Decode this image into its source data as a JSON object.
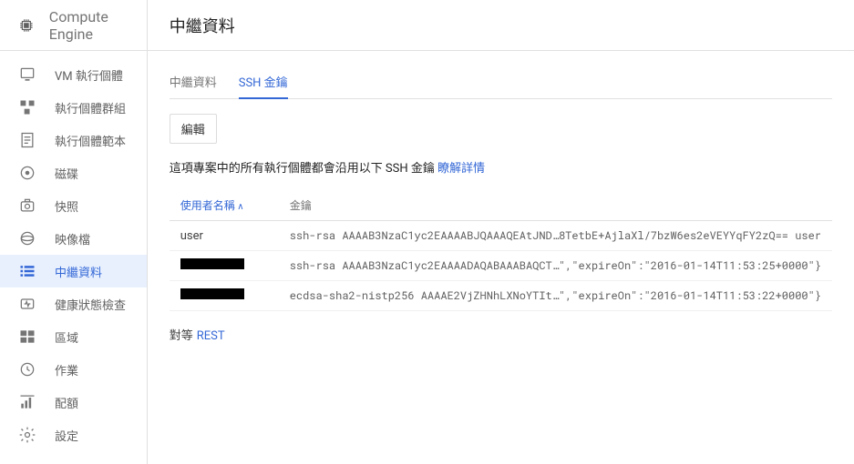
{
  "product_name": "Compute Engine",
  "page_title": "中繼資料",
  "sidebar": {
    "items": [
      {
        "label": "VM 執行個體"
      },
      {
        "label": "執行個體群組"
      },
      {
        "label": "執行個體範本"
      },
      {
        "label": "磁碟"
      },
      {
        "label": "快照"
      },
      {
        "label": "映像檔"
      },
      {
        "label": "中繼資料"
      },
      {
        "label": "健康狀態檢查"
      },
      {
        "label": "區域"
      },
      {
        "label": "作業"
      },
      {
        "label": "配額"
      },
      {
        "label": "設定"
      }
    ]
  },
  "tabs": {
    "metadata": "中繼資料",
    "ssh_keys": "SSH 金鑰"
  },
  "edit_button": "編輯",
  "description_prefix": "這項專案中的所有執行個體都會沿用以下 SSH 金鑰 ",
  "description_link": "瞭解詳情",
  "table": {
    "col_user": "使用者名稱",
    "col_key": "金鑰",
    "rows": [
      {
        "user": "user",
        "key": "ssh-rsa AAAAB3NzaC1yc2EAAAABJQAAAQEAtJND…8TetbE+AjlaXl/7bzW6es2eVEYYqFY2zQ== user"
      },
      {
        "user": "",
        "key": "ssh-rsa AAAAB3NzaC1yc2EAAAADAQABAAABAQCT…\",\"expireOn\":\"2016-01-14T11:53:25+0000\"}"
      },
      {
        "user": "",
        "key": "ecdsa-sha2-nistp256 AAAAE2VjZHNhLXNoYTIt…\",\"expireOn\":\"2016-01-14T11:53:22+0000\"}"
      }
    ]
  },
  "footer": {
    "lead": "對等",
    "link": "REST"
  }
}
